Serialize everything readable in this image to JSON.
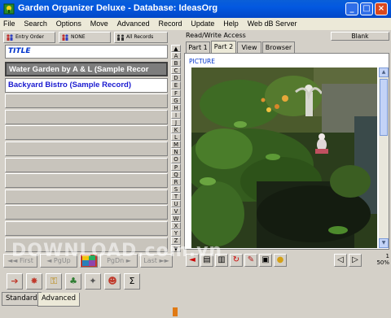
{
  "window": {
    "title": "Garden Organizer Deluxe - Database: IdeasOrg",
    "controls": [
      "_",
      "□",
      "×"
    ]
  },
  "menu": [
    "File",
    "Search",
    "Options",
    "Move",
    "Advanced",
    "Record",
    "Update",
    "Help",
    "Web dB Server"
  ],
  "filters": [
    {
      "label": "Entry Order"
    },
    {
      "label": "NONE"
    },
    {
      "label": "All Records"
    }
  ],
  "field_title_label": "TITLE",
  "records": [
    {
      "label": "Water Garden by A & L (Sample Recor",
      "state": "selected"
    },
    {
      "label": "Backyard Bistro (Sample Record)",
      "state": "normal"
    },
    {
      "label": ""
    },
    {
      "label": ""
    },
    {
      "label": ""
    },
    {
      "label": ""
    },
    {
      "label": ""
    },
    {
      "label": ""
    },
    {
      "label": ""
    },
    {
      "label": ""
    },
    {
      "label": ""
    },
    {
      "label": ""
    }
  ],
  "alphabet": [
    "A",
    "B",
    "C",
    "D",
    "E",
    "F",
    "G",
    "H",
    "I",
    "J",
    "K",
    "L",
    "M",
    "N",
    "O",
    "P",
    "Q",
    "R",
    "S",
    "T",
    "U",
    "V",
    "W",
    "X",
    "Y",
    "Z"
  ],
  "nav": {
    "first": "First",
    "pgup": "PgUp",
    "pgdn": "PgDn",
    "last": "Last"
  },
  "right": {
    "access": "Read/Write Access",
    "blank_button": "Blank",
    "tabs": [
      "Part 1",
      "Part 2",
      "View",
      "Browser"
    ],
    "active_tab": 1,
    "picture_label": "PICTURE",
    "zoom_value": "50%",
    "zoom_step": "1"
  },
  "bottom_tabs": [
    "Standard",
    "Advanced"
  ],
  "watermark": "DOWNLOAD.com.vn",
  "colors": {
    "title_blue": "#0147c7",
    "record_blue": "#1a1ad0",
    "label_blue": "#0033cc"
  }
}
